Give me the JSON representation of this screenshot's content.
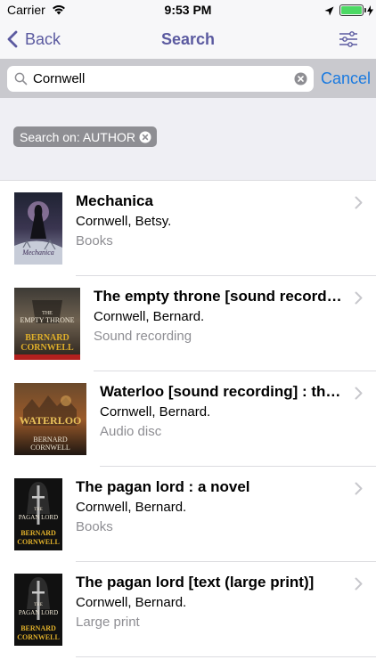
{
  "status_bar": {
    "carrier": "Carrier",
    "time": "9:53 PM"
  },
  "nav": {
    "back_label": "Back",
    "title": "Search"
  },
  "search": {
    "value": "Cornwell",
    "cancel_label": "Cancel"
  },
  "filter_chip": {
    "label": "Search on: AUTHOR"
  },
  "results": [
    {
      "title": "Mechanica",
      "author": "Cornwell, Betsy.",
      "format": "Books",
      "cover_text": [
        "Mechanica"
      ]
    },
    {
      "title": "The empty throne [sound recording] : a novel",
      "author": "Cornwell, Bernard.",
      "format": "Sound recording",
      "cover_text": [
        "THE",
        "EMPTY THRONE",
        "BERNARD",
        "CORNWELL"
      ]
    },
    {
      "title": "Waterloo [sound recording] : the history of four days, three armies and three battles",
      "author": "Cornwell, Bernard.",
      "format": "Audio disc",
      "cover_text": [
        "WATERLOO",
        "BERNARD",
        "CORNWELL"
      ]
    },
    {
      "title": "The pagan lord : a novel",
      "author": "Cornwell, Bernard.",
      "format": "Books",
      "cover_text": [
        "THE",
        "PAGAN LORD",
        "BERNARD",
        "CORNWELL"
      ]
    },
    {
      "title": "The pagan lord [text (large print)]",
      "author": "Cornwell, Bernard.",
      "format": "Large print",
      "cover_text": [
        "THE",
        "PAGAN LORD",
        "BERNARD",
        "CORNWELL"
      ]
    }
  ],
  "colors": {
    "accent": "#5b5aa0",
    "cancel": "#1a7ae0",
    "chip": "#8e8e93",
    "battery": "#4cd964"
  }
}
